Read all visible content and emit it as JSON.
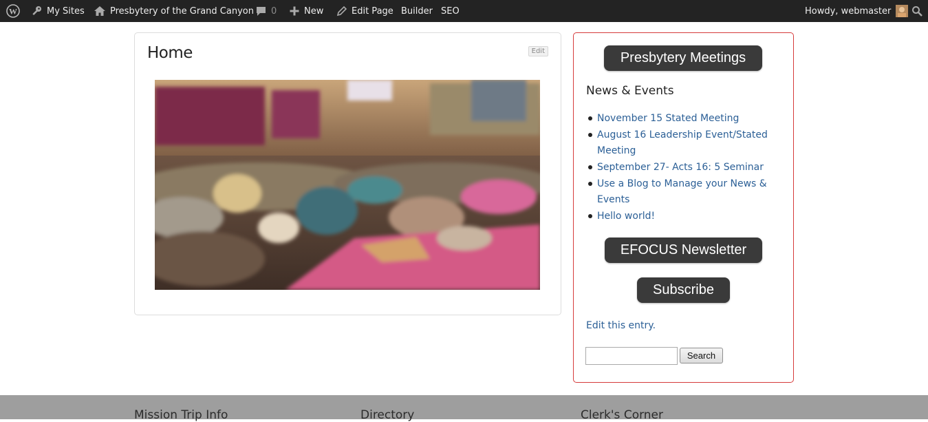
{
  "admin_bar": {
    "my_sites": "My Sites",
    "site_name": "Presbytery of the Grand Canyon",
    "comments_count": "0",
    "new_label": "New",
    "edit_page": "Edit Page",
    "builder": "Builder",
    "seo": "SEO",
    "greeting": "Howdy, webmaster"
  },
  "main": {
    "title": "Home",
    "edit_label": "Edit"
  },
  "sidebar": {
    "meetings_button": "Presbytery Meetings",
    "news_heading": "News & Events",
    "news_items": [
      "November 15 Stated Meeting",
      "August 16 Leadership Event/Stated Meeting",
      "September 27- Acts 16: 5 Seminar",
      "Use a Blog to Manage your News & Events",
      "Hello world!"
    ],
    "newsletter_button": "EFOCUS Newsletter",
    "subscribe_button": "Subscribe",
    "edit_entry": "Edit this entry.",
    "search_value": "",
    "search_button": "Search"
  },
  "footer": {
    "col1": "Mission Trip Info",
    "col2": "Directory",
    "col3": "Clerk's Corner"
  },
  "colors": {
    "admin_bar_bg": "#232323",
    "link": "#2b5f96",
    "sidebar_border": "#d63a3a",
    "pill_bg": "#3a3a3a",
    "footer_bg": "#9e9e9e"
  }
}
